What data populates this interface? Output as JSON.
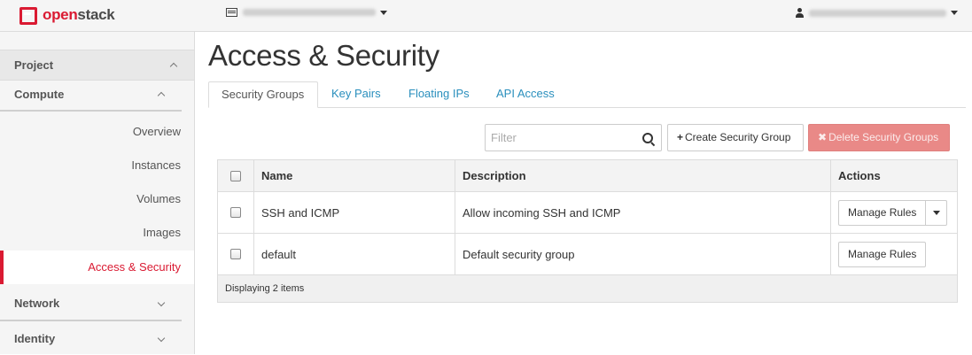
{
  "header": {
    "brand_prefix": "open",
    "brand_suffix": "stack"
  },
  "sidebar": {
    "project": "Project",
    "compute": "Compute",
    "items": [
      {
        "label": "Overview"
      },
      {
        "label": "Instances"
      },
      {
        "label": "Volumes"
      },
      {
        "label": "Images"
      },
      {
        "label": "Access & Security"
      }
    ],
    "network": "Network",
    "identity": "Identity"
  },
  "main": {
    "title": "Access & Security",
    "tabs": [
      "Security Groups",
      "Key Pairs",
      "Floating IPs",
      "API Access"
    ],
    "filter_placeholder": "Filter",
    "create_label": "Create Security Group",
    "delete_label": "Delete Security Groups"
  },
  "table": {
    "columns": [
      "Name",
      "Description",
      "Actions"
    ],
    "rows": [
      {
        "name": "SSH and ICMP",
        "description": "Allow incoming SSH and ICMP",
        "action": "Manage Rules"
      },
      {
        "name": "default",
        "description": "Default security group",
        "action": "Manage Rules"
      }
    ],
    "footer": "Displaying 2 items"
  },
  "colors": {
    "brand_red": "#da1a32",
    "link_blue": "#2a8fbd",
    "danger_button": "#e98987"
  },
  "icons": [
    "logo-icon",
    "project-selector-icon",
    "user-icon",
    "chevron-up-icon",
    "chevron-down-icon",
    "search-icon",
    "plus-icon",
    "close-icon",
    "caret-down-icon"
  ]
}
